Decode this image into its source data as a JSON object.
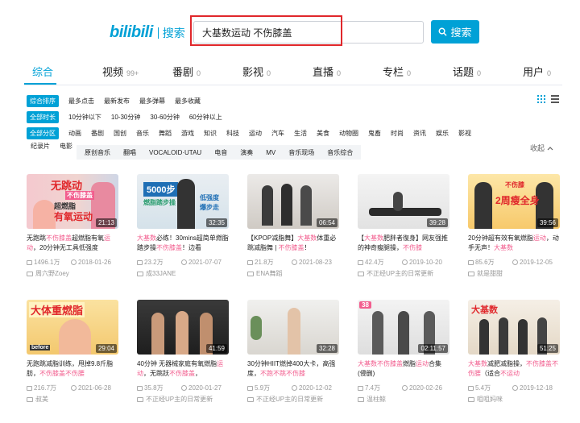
{
  "logo": {
    "brand": "bilibili",
    "sub": "搜索"
  },
  "search": {
    "query": "大基数运动 不伤膝盖",
    "button_label": "搜索"
  },
  "tabs": [
    {
      "label": "综合",
      "count": ""
    },
    {
      "label": "视频",
      "count": "99+"
    },
    {
      "label": "番剧",
      "count": "0"
    },
    {
      "label": "影视",
      "count": "0"
    },
    {
      "label": "直播",
      "count": "0"
    },
    {
      "label": "专栏",
      "count": "0"
    },
    {
      "label": "话题",
      "count": "0"
    },
    {
      "label": "用户",
      "count": "0"
    }
  ],
  "filters": {
    "order": {
      "pill": "综合排序",
      "options": [
        "最多点击",
        "最新发布",
        "最多弹幕",
        "最多收藏"
      ]
    },
    "duration": {
      "pill": "全部时长",
      "options": [
        "10分钟以下",
        "10-30分钟",
        "30-60分钟",
        "60分钟以上"
      ]
    },
    "zone": {
      "pill": "全部分区",
      "options": [
        "动画",
        "番剧",
        "国创",
        "音乐",
        "舞蹈",
        "游戏",
        "知识",
        "科技",
        "运动",
        "汽车",
        "生活",
        "美食",
        "动物圈",
        "鬼畜",
        "时尚",
        "资讯",
        "娱乐",
        "影视"
      ]
    },
    "zone_more": [
      "纪录片",
      "电影"
    ],
    "sub_options": [
      "原创音乐",
      "翻唱",
      "VOCALOID·UTAU",
      "电音",
      "演奏",
      "MV",
      "音乐现场",
      "音乐综合"
    ],
    "collapse_label": "收起"
  },
  "videos": [
    {
      "duration": "21:13",
      "title_parts": [
        [
          "无跑跳",
          ""
        ],
        [
          "不伤膝盖",
          "hl"
        ],
        [
          "超燃脂有氧",
          ""
        ],
        [
          "运动",
          "hl"
        ],
        [
          "，20分钟无工具低强度",
          ""
        ]
      ],
      "views": "1496.1万",
      "date": "2018-01-26",
      "uploader": "周六野Zoey",
      "thumb_text": [
        "无跳动",
        "不伤膝盖",
        "超燃脂",
        "有氧运动"
      ]
    },
    {
      "duration": "32:35",
      "title_parts": [
        [
          "大基数",
          "hl"
        ],
        [
          "必练！30mins超简单燃脂踏步操",
          ""
        ],
        [
          "不伤膝盖",
          "hl"
        ],
        [
          "！边看",
          ""
        ]
      ],
      "views": "23.2万",
      "date": "2021-07-07",
      "uploader": "成33JANE",
      "thumb_text": [
        "5000步",
        "燃脂踏步操",
        "低强度",
        "爆步走"
      ]
    },
    {
      "duration": "06:54",
      "title_parts": [
        [
          "【KPOP减脂舞】",
          ""
        ],
        [
          "大基数",
          "hl"
        ],
        [
          "体重必跳减脂舞 | ",
          ""
        ],
        [
          "不伤膝盖",
          "hl"
        ],
        [
          "！",
          ""
        ]
      ],
      "views": "21.8万",
      "date": "2021-08-23",
      "uploader": "ENA舞蹈",
      "thumb_text": []
    },
    {
      "duration": "39:28",
      "title_parts": [
        [
          "【",
          ""
        ],
        [
          "大基数",
          "hl"
        ],
        [
          "肥胖者復身】网友强推的神奇瘦腿操，",
          ""
        ],
        [
          "不伤膝",
          "hl"
        ]
      ],
      "views": "42.4万",
      "date": "2019-10-20",
      "uploader": "不正经UP主的日常更新",
      "thumb_text": []
    },
    {
      "duration": "39:56",
      "title_parts": [
        [
          "20分钟超有效有氧燃脂",
          ""
        ],
        [
          "运动",
          "hl"
        ],
        [
          "，动手无声！",
          ""
        ],
        [
          "大基数",
          "hl"
        ]
      ],
      "views": "85.6万",
      "date": "2019-12-05",
      "uploader": "就是甜甜",
      "thumb_text": [
        "2周瘦全身",
        "不伤膝"
      ]
    },
    {
      "duration": "29:04",
      "title_parts": [
        [
          "无跑跳减脂训练，甩掉9.8斤脂肪，",
          ""
        ],
        [
          "不伤膝盖",
          "hl"
        ],
        [
          "不伤腰",
          "hl"
        ]
      ],
      "views": "216.7万",
      "date": "2021-06-28",
      "uploader": "叔美",
      "thumb_text": [
        "大体重燃脂",
        "before"
      ]
    },
    {
      "duration": "41:59",
      "title_parts": [
        [
          "40分钟 无器械家庭有氧燃脂",
          ""
        ],
        [
          "运动",
          "hl"
        ],
        [
          "，无跳跃",
          ""
        ],
        [
          "不伤膝盖",
          "hl"
        ],
        [
          "，",
          ""
        ]
      ],
      "views": "35.8万",
      "date": "2020-01-27",
      "uploader": "不正经UP主的日常更新",
      "thumb_text": []
    },
    {
      "duration": "32:28",
      "title_parts": [
        [
          "30分钟HIIT燃掉400大卡，高强度，",
          ""
        ],
        [
          "不跑不跳",
          "hl"
        ],
        [
          "不伤膝",
          "hl"
        ]
      ],
      "views": "5.9万",
      "date": "2020-12-02",
      "uploader": "不正经UP主的日常更新",
      "thumb_text": []
    },
    {
      "duration": "02:11:57",
      "title_parts": [
        [
          "大基数",
          "hl"
        ],
        [
          "不伤膝盖",
          "hl"
        ],
        [
          "燃脂",
          ""
        ],
        [
          "运动",
          "hl"
        ],
        [
          "合集(侵删)",
          ""
        ]
      ],
      "views": "7.4万",
      "date": "2020-02-26",
      "uploader": "温柱鲸",
      "thumb_text": [
        "38"
      ]
    },
    {
      "duration": "51:25",
      "title_parts": [
        [
          "大基数",
          "hl"
        ],
        [
          "减肥减脂操，",
          ""
        ],
        [
          "不伤膝盖不伤腰",
          "hl"
        ],
        [
          "（适合",
          ""
        ],
        [
          "不运动",
          "hl"
        ],
        [
          "",
          ""
        ]
      ],
      "views": "5.4万",
      "date": "2019-12-18",
      "uploader": "咀咀妈咪",
      "thumb_text": [
        "大基数"
      ]
    }
  ],
  "colors": {
    "accent": "#00a1d6",
    "highlight": "#f25d8e",
    "alert": "#e0272b"
  },
  "icons": [
    "search-icon",
    "grid-view-icon",
    "list-view-icon",
    "view-count-icon",
    "clock-icon",
    "uploader-icon",
    "chevron-up-icon"
  ]
}
